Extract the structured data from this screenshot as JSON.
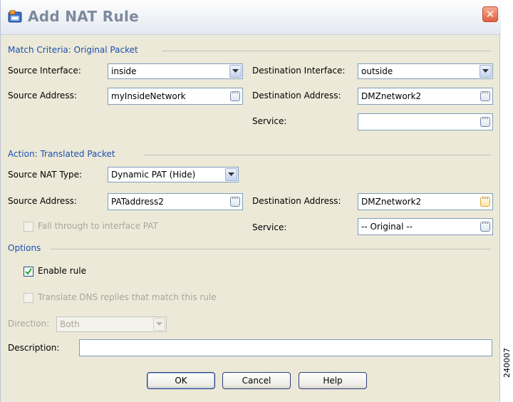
{
  "dialog": {
    "title": "Add NAT Rule",
    "close_symbol": "✕"
  },
  "match_criteria": {
    "heading": "Match Criteria: Original Packet",
    "source_interface_label": "Source Interface:",
    "source_interface_value": "inside",
    "destination_interface_label": "Destination Interface:",
    "destination_interface_value": "outside",
    "source_address_label": "Source Address:",
    "source_address_value": "myInsideNetwork",
    "destination_address_label": "Destination Address:",
    "destination_address_value": "DMZnetwork2",
    "service_label": "Service:",
    "service_value": ""
  },
  "action": {
    "heading": "Action: Translated Packet",
    "source_nat_type_label": "Source NAT Type:",
    "source_nat_type_value": "Dynamic PAT (Hide)",
    "source_address_label": "Source Address:",
    "source_address_value": "PATaddress2",
    "destination_address_label": "Destination Address:",
    "destination_address_value": "DMZnetwork2",
    "fall_through_label": "Fall through to interface PAT",
    "service_label": "Service:",
    "service_value": "-- Original --"
  },
  "options": {
    "heading": "Options",
    "enable_rule_label": "Enable rule",
    "enable_rule_checked": true,
    "translate_dns_label": "Translate DNS replies that match this rule",
    "direction_label": "Direction:",
    "direction_value": "Both",
    "description_label": "Description:",
    "description_value": ""
  },
  "buttons": {
    "ok": "OK",
    "cancel": "Cancel",
    "help": "Help"
  },
  "watermark": "240007",
  "browse_symbol": "...",
  "colors": {
    "section_heading": "#1b4fb0",
    "dialog_background": "#ece9d8",
    "disabled_text": "#a9a69a"
  }
}
